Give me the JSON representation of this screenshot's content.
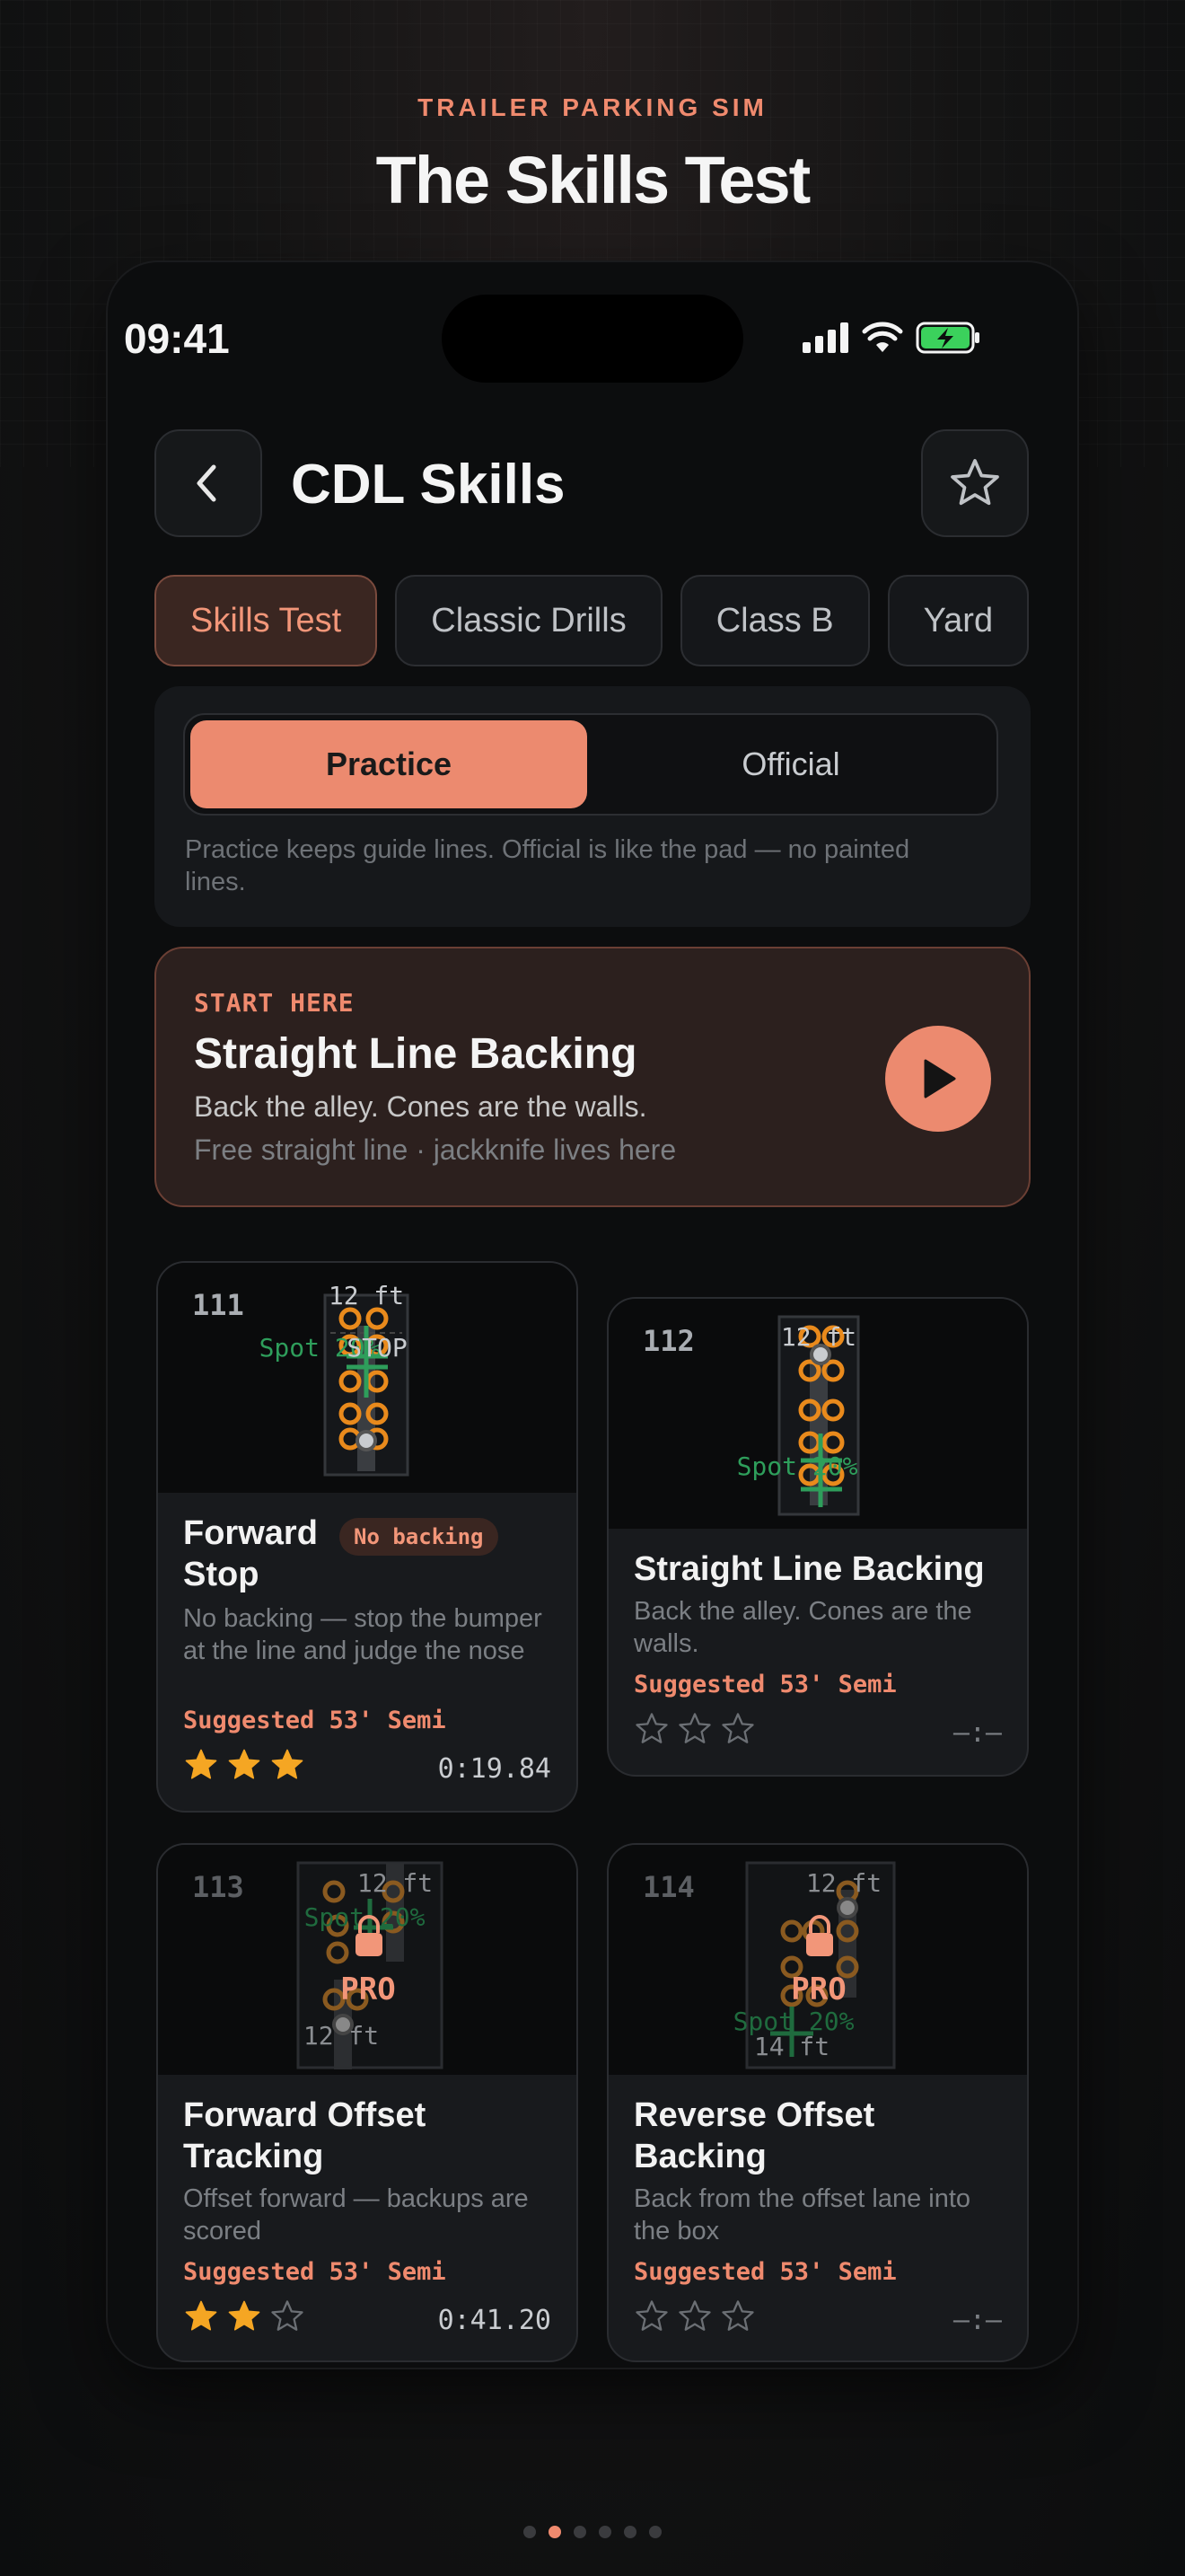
{
  "hero": {
    "eyebrow": "TRAILER PARKING SIM",
    "title": "The Skills Test"
  },
  "status_bar": {
    "time": "09:41",
    "icons": [
      "signal-icon",
      "wifi-icon",
      "battery-charging-icon"
    ]
  },
  "header": {
    "title": "CDL Skills",
    "back_icon": "chevron-left-icon",
    "favorite_icon": "star-outline-icon"
  },
  "category_tabs": [
    {
      "label": "Skills Test",
      "active": true
    },
    {
      "label": "Classic Drills",
      "active": false
    },
    {
      "label": "Class B",
      "active": false
    },
    {
      "label": "Yard",
      "active": false
    }
  ],
  "mode": {
    "options": [
      "Practice",
      "Official"
    ],
    "selected": "Practice",
    "hint": "Practice keeps guide lines. Official is like the pad — no painted lines."
  },
  "featured": {
    "eyebrow": "START HERE",
    "title": "Straight Line Backing",
    "subtitle": "Back the alley. Cones are the walls.",
    "meta": "Free straight line · jackknife lives here"
  },
  "cards": [
    {
      "number": "111",
      "title_line1": "Forward",
      "title_line2": "Stop",
      "badge": "No backing",
      "description": "No backing — stop the bumper at the line and judge the nose",
      "suggested": "Suggested 53' Semi",
      "stars_earned": 3,
      "time": "0:19.84",
      "locked": false,
      "thumb": {
        "width_label": "12 ft",
        "spot_label": "Spot 20%",
        "stop_label": "STOP"
      }
    },
    {
      "number": "112",
      "title_line1": "Straight Line Backing",
      "title_line2": "",
      "badge": "",
      "description": "Back the alley. Cones are the walls.",
      "suggested": "Suggested 53' Semi",
      "stars_earned": 0,
      "time": "–:—",
      "locked": false,
      "thumb": {
        "width_label": "12 ft",
        "spot_label": "Spot 20%"
      }
    },
    {
      "number": "113",
      "title_line1": "Forward Offset",
      "title_line2": "Tracking",
      "badge": "",
      "description": "Offset forward — backups are scored",
      "suggested": "Suggested 53' Semi",
      "stars_earned": 2,
      "time": "0:41.20",
      "locked": true,
      "lock_label": "PRO",
      "thumb": {
        "width_label": "12 ft",
        "width_label_2": "12 ft",
        "spot_label": "Spot 20%"
      }
    },
    {
      "number": "114",
      "title_line1": "Reverse Offset",
      "title_line2": "Backing",
      "badge": "",
      "description": "Back from the offset lane into the box",
      "suggested": "Suggested 53' Semi",
      "stars_earned": 0,
      "time": "–:—",
      "locked": true,
      "lock_label": "PRO",
      "thumb": {
        "width_label": "12 ft",
        "width_label_2": "14 ft",
        "spot_label": "Spot 20%"
      }
    }
  ],
  "pager": {
    "count": 6,
    "active_index": 1
  },
  "colors": {
    "accent": "#ec8a6f",
    "star": "#f5a623",
    "spot_green": "#2e9e5b",
    "cone": "#e98a1c"
  }
}
